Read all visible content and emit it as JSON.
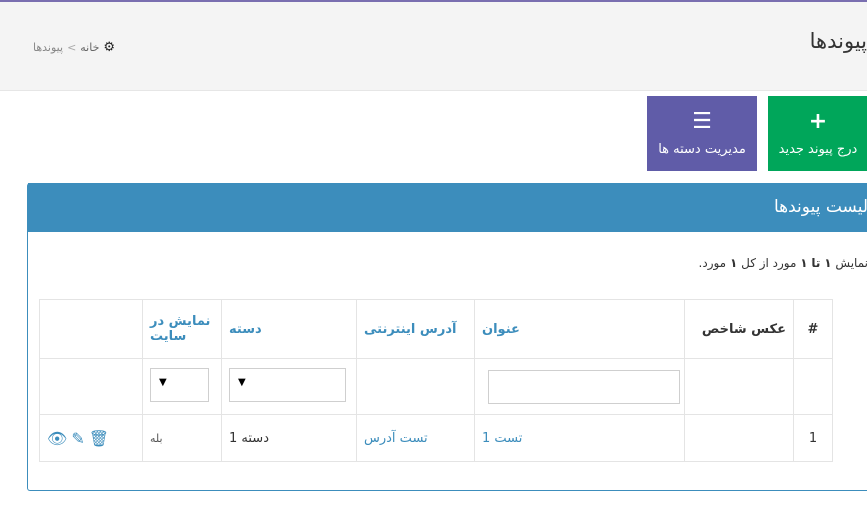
{
  "header": {
    "page_title": "پیوندها",
    "breadcrumb": {
      "home_label": "خانه",
      "separator": ">",
      "current": "پیوندها"
    }
  },
  "toolbar": {
    "add_label": "درج پیوند جدید",
    "add_icon": "plus-icon",
    "categories_label": "مدیریت دسته ها",
    "categories_icon": "list-icon"
  },
  "box": {
    "title": "لیست پیوندها",
    "summary": {
      "prefix": "نمایش",
      "from": "۱",
      "to_word": "تا",
      "to": "۱",
      "middle": "مورد از کل",
      "total": "۱",
      "suffix": "مورد."
    }
  },
  "table": {
    "columns": {
      "hash": "#",
      "photo": "عکس شاخص",
      "title": "عنوان",
      "url": "آدرس اینترنتی",
      "category": "دسته",
      "show": "نمایش در سایت"
    },
    "rows": [
      {
        "id": "1",
        "photo": "",
        "title": "تست 1",
        "url": "تست آدرس",
        "category": "دسته 1",
        "show": "بله"
      }
    ]
  },
  "colors": {
    "primary": "#3c8dbc",
    "success": "#00a65a",
    "purple": "#605ca8"
  }
}
